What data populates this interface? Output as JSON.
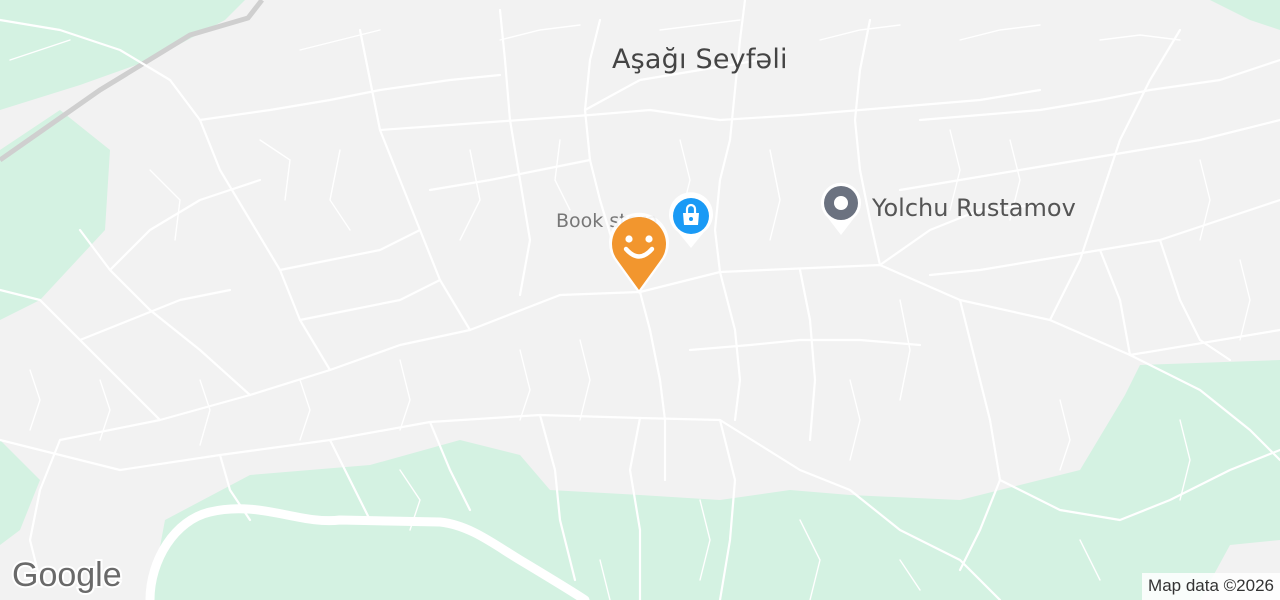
{
  "map": {
    "town_label": "Aşağı Seyfəli",
    "poi": {
      "name": "Yolchu Rustamov",
      "icon": "place-pin-icon"
    },
    "shop": {
      "name": "Book store",
      "icon": "shopping-bag-icon"
    },
    "user_marker": {
      "icon": "smiley-face-pin-icon"
    },
    "colors": {
      "land": "#f2f2f2",
      "park": "#d4f2e2",
      "road": "#ffffff",
      "highway": "#d0d0d0",
      "shop_pin": "#1a9af5",
      "user_pin": "#f2962e",
      "poi_pin": "#6b7280"
    }
  },
  "brand": {
    "logo_text": "Google"
  },
  "attribution": {
    "text": "Map data ©2026"
  }
}
